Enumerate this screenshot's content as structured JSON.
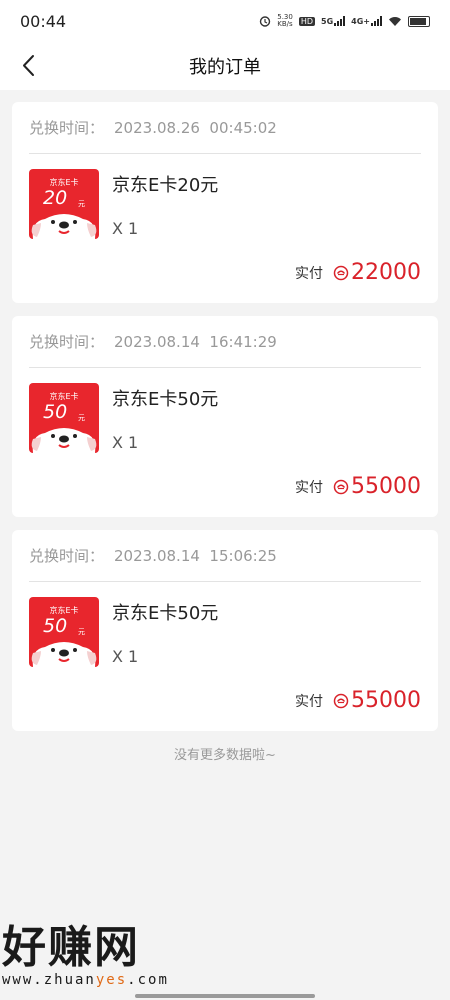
{
  "status_bar": {
    "time": "00:44",
    "speed": "5.30",
    "speed_unit": "KB/s",
    "hd": "HD",
    "net1": "5G",
    "net2": "4G+"
  },
  "header": {
    "title": "我的订单"
  },
  "orders": [
    {
      "time_label": "兑换时间：",
      "time": "2023.08.26  00:45:02",
      "card_brand": "京东E卡",
      "card_amount": "20",
      "card_unit": "元",
      "product": "京东E卡20元",
      "qty": "X 1",
      "pay_label": "实付",
      "pay_value": "22000"
    },
    {
      "time_label": "兑换时间：",
      "time": "2023.08.14  16:41:29",
      "card_brand": "京东E卡",
      "card_amount": "50",
      "card_unit": "元",
      "product": "京东E卡50元",
      "qty": "X 1",
      "pay_label": "实付",
      "pay_value": "55000"
    },
    {
      "time_label": "兑换时间：",
      "time": "2023.08.14  15:06:25",
      "card_brand": "京东E卡",
      "card_amount": "50",
      "card_unit": "元",
      "product": "京东E卡50元",
      "qty": "X 1",
      "pay_label": "实付",
      "pay_value": "55000"
    }
  ],
  "footer": {
    "no_more": "没有更多数据啦~"
  },
  "watermark": {
    "main": "好赚网",
    "sub_pre": "www.zhuan",
    "sub_hl": "yes",
    "sub_post": ".com"
  },
  "colors": {
    "accent": "#d9222a",
    "card_red": "#e8262d"
  },
  "icons": {
    "back": "chevron-left-icon",
    "coin": "coin-icon"
  }
}
